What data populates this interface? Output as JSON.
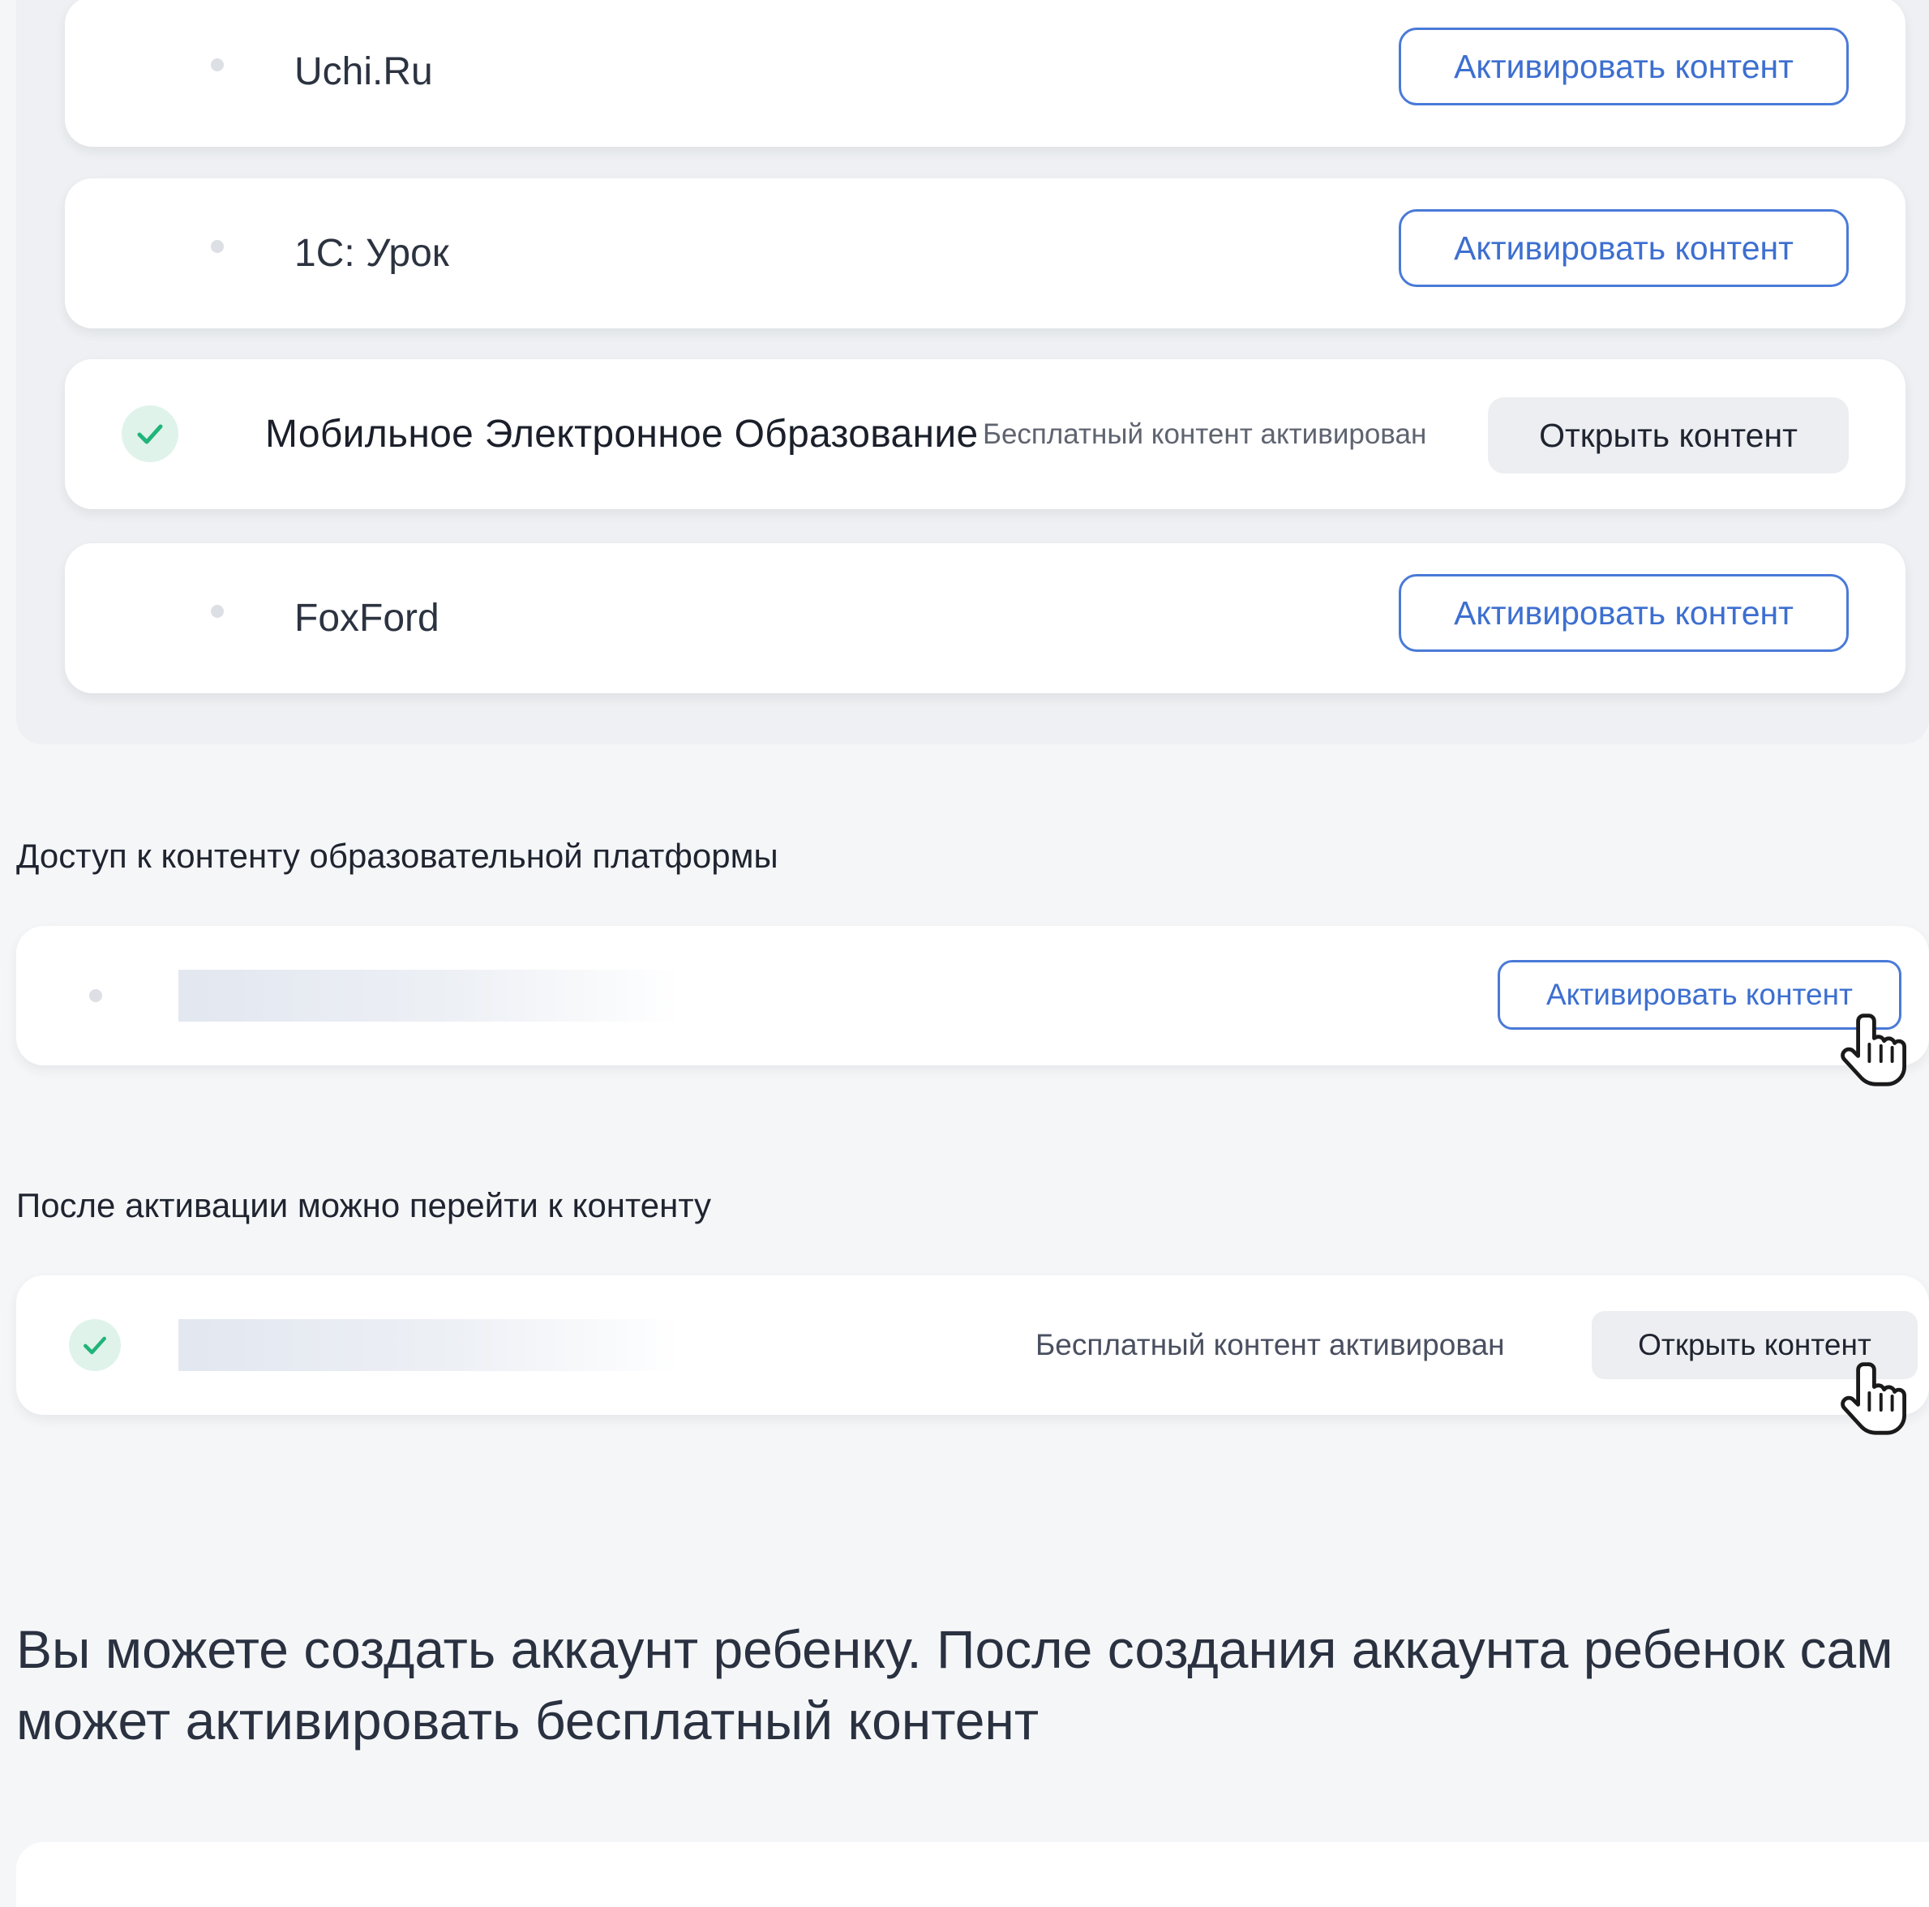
{
  "providers": [
    {
      "name": "Uchi.Ru",
      "activated": false,
      "button": "Активировать контент"
    },
    {
      "name": "1С: Урок",
      "activated": false,
      "button": "Активировать контент"
    },
    {
      "name": "Мобильное Электронное Образование",
      "activated": true,
      "status": "Бесплатный контент активирован",
      "button": "Открыть контент"
    },
    {
      "name": "FoxFord",
      "activated": false,
      "button": "Активировать контент"
    }
  ],
  "access_section": {
    "heading": "Доступ к контенту образовательной платформы",
    "button": "Активировать контент"
  },
  "after_section": {
    "heading": "После активации можно перейти к контенту",
    "status": "Бесплатный контент активирован",
    "button": "Открыть контент"
  },
  "child_account_text": "Вы можете создать аккаунт ребенку. После создания аккаунта ребенок сам может активировать бесплатный контент",
  "icons": {
    "pending": "dot-icon",
    "activated": "check-icon",
    "cursor": "hand-pointer-icon"
  },
  "colors": {
    "accent": "#3d6fd0",
    "check": "#21b47a",
    "check_bg": "#dff3ea"
  }
}
